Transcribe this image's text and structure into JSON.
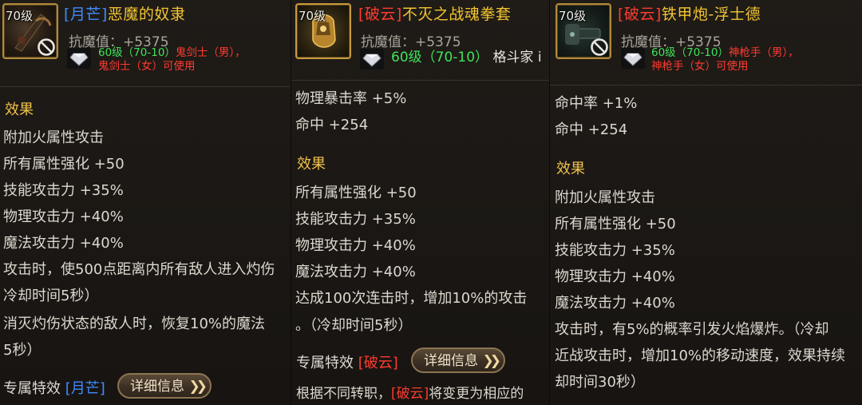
{
  "panels": [
    {
      "level": "70级",
      "title_sect": "[月芒]",
      "title_name": "恶魔的奴隶",
      "resist": "抗魔值：+5375",
      "req_level": "60级（70-10）",
      "req_class_1": "鬼剑士（男），",
      "req_class_2": "鬼剑士（女）可使用",
      "lines": [
        "效果",
        "附加火属性攻击",
        "所有属性强化 +50",
        "技能攻击力 +35%",
        "物理攻击力 +40%",
        "魔法攻击力 +40%",
        "攻击时，使500点距离内所有敌人进入灼伤",
        "冷却时间5秒）",
        "消灭灼伤状态的敌人时，恢复10%的魔法",
        "5秒）"
      ],
      "exclusive_label": "专属特效",
      "exclusive_sect": "[月芒]",
      "detail_label": "详细信息"
    },
    {
      "level": "70级",
      "title_sect": "[破云]",
      "title_name": "不灭之战魂拳套",
      "resist": "抗魔值：+5375",
      "req_level": "60级（70-10）",
      "req_class_1": "格斗家 i",
      "lines": [
        "物理暴击率 +5%",
        "命中 +254",
        "效果",
        "所有属性强化 +50",
        "技能攻击力 +35%",
        "物理攻击力 +40%",
        "魔法攻击力 +40%",
        "达成100次连击时，增加10%的攻击",
        "。（冷却时间5秒）"
      ],
      "exclusive_label": "专属特效",
      "exclusive_sect": "[破云]",
      "detail_label": "详细信息",
      "footer_prefix": "根据不同转职，",
      "footer_sect": "[破云]",
      "footer_suffix": "将变更为相应的"
    },
    {
      "level": "70级",
      "title_sect": "[破云]",
      "title_name": "铁甲炮-浮士德",
      "resist": "抗魔值：+5375",
      "req_level": "60级（70-10）",
      "req_class_1": "神枪手（男），",
      "req_class_2": "神枪手（女）可使用",
      "lines": [
        "命中率 +1%",
        "命中 +254",
        "效果",
        "附加火属性攻击",
        "所有属性强化 +50",
        "技能攻击力 +35%",
        "物理攻击力 +40%",
        "魔法攻击力 +40%",
        "攻击时，有5%的概率引发火焰爆炸。（冷却",
        "近战攻击时，增加10%的移动速度，效果持续",
        "却时间30秒）"
      ]
    }
  ],
  "colors": {
    "sect_blue": "#3f8cff",
    "sect_red": "#ff3b2f",
    "title_gold": "#f3c531",
    "header_gold": "#f0c24a",
    "req_green": "#3ee35a"
  }
}
